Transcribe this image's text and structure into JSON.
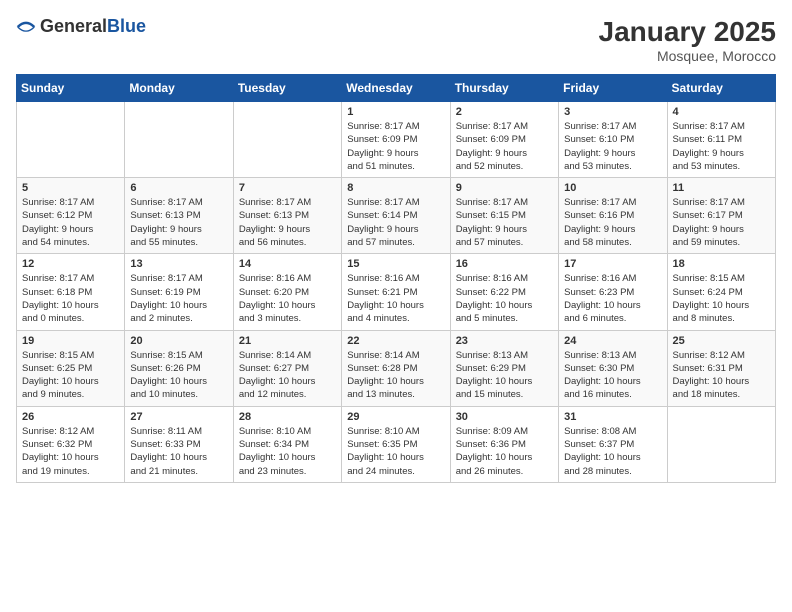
{
  "header": {
    "logo_general": "General",
    "logo_blue": "Blue",
    "month_year": "January 2025",
    "location": "Mosquee, Morocco"
  },
  "weekdays": [
    "Sunday",
    "Monday",
    "Tuesday",
    "Wednesday",
    "Thursday",
    "Friday",
    "Saturday"
  ],
  "weeks": [
    [
      {
        "day": "",
        "info": ""
      },
      {
        "day": "",
        "info": ""
      },
      {
        "day": "",
        "info": ""
      },
      {
        "day": "1",
        "info": "Sunrise: 8:17 AM\nSunset: 6:09 PM\nDaylight: 9 hours\nand 51 minutes."
      },
      {
        "day": "2",
        "info": "Sunrise: 8:17 AM\nSunset: 6:09 PM\nDaylight: 9 hours\nand 52 minutes."
      },
      {
        "day": "3",
        "info": "Sunrise: 8:17 AM\nSunset: 6:10 PM\nDaylight: 9 hours\nand 53 minutes."
      },
      {
        "day": "4",
        "info": "Sunrise: 8:17 AM\nSunset: 6:11 PM\nDaylight: 9 hours\nand 53 minutes."
      }
    ],
    [
      {
        "day": "5",
        "info": "Sunrise: 8:17 AM\nSunset: 6:12 PM\nDaylight: 9 hours\nand 54 minutes."
      },
      {
        "day": "6",
        "info": "Sunrise: 8:17 AM\nSunset: 6:13 PM\nDaylight: 9 hours\nand 55 minutes."
      },
      {
        "day": "7",
        "info": "Sunrise: 8:17 AM\nSunset: 6:13 PM\nDaylight: 9 hours\nand 56 minutes."
      },
      {
        "day": "8",
        "info": "Sunrise: 8:17 AM\nSunset: 6:14 PM\nDaylight: 9 hours\nand 57 minutes."
      },
      {
        "day": "9",
        "info": "Sunrise: 8:17 AM\nSunset: 6:15 PM\nDaylight: 9 hours\nand 57 minutes."
      },
      {
        "day": "10",
        "info": "Sunrise: 8:17 AM\nSunset: 6:16 PM\nDaylight: 9 hours\nand 58 minutes."
      },
      {
        "day": "11",
        "info": "Sunrise: 8:17 AM\nSunset: 6:17 PM\nDaylight: 9 hours\nand 59 minutes."
      }
    ],
    [
      {
        "day": "12",
        "info": "Sunrise: 8:17 AM\nSunset: 6:18 PM\nDaylight: 10 hours\nand 0 minutes."
      },
      {
        "day": "13",
        "info": "Sunrise: 8:17 AM\nSunset: 6:19 PM\nDaylight: 10 hours\nand 2 minutes."
      },
      {
        "day": "14",
        "info": "Sunrise: 8:16 AM\nSunset: 6:20 PM\nDaylight: 10 hours\nand 3 minutes."
      },
      {
        "day": "15",
        "info": "Sunrise: 8:16 AM\nSunset: 6:21 PM\nDaylight: 10 hours\nand 4 minutes."
      },
      {
        "day": "16",
        "info": "Sunrise: 8:16 AM\nSunset: 6:22 PM\nDaylight: 10 hours\nand 5 minutes."
      },
      {
        "day": "17",
        "info": "Sunrise: 8:16 AM\nSunset: 6:23 PM\nDaylight: 10 hours\nand 6 minutes."
      },
      {
        "day": "18",
        "info": "Sunrise: 8:15 AM\nSunset: 6:24 PM\nDaylight: 10 hours\nand 8 minutes."
      }
    ],
    [
      {
        "day": "19",
        "info": "Sunrise: 8:15 AM\nSunset: 6:25 PM\nDaylight: 10 hours\nand 9 minutes."
      },
      {
        "day": "20",
        "info": "Sunrise: 8:15 AM\nSunset: 6:26 PM\nDaylight: 10 hours\nand 10 minutes."
      },
      {
        "day": "21",
        "info": "Sunrise: 8:14 AM\nSunset: 6:27 PM\nDaylight: 10 hours\nand 12 minutes."
      },
      {
        "day": "22",
        "info": "Sunrise: 8:14 AM\nSunset: 6:28 PM\nDaylight: 10 hours\nand 13 minutes."
      },
      {
        "day": "23",
        "info": "Sunrise: 8:13 AM\nSunset: 6:29 PM\nDaylight: 10 hours\nand 15 minutes."
      },
      {
        "day": "24",
        "info": "Sunrise: 8:13 AM\nSunset: 6:30 PM\nDaylight: 10 hours\nand 16 minutes."
      },
      {
        "day": "25",
        "info": "Sunrise: 8:12 AM\nSunset: 6:31 PM\nDaylight: 10 hours\nand 18 minutes."
      }
    ],
    [
      {
        "day": "26",
        "info": "Sunrise: 8:12 AM\nSunset: 6:32 PM\nDaylight: 10 hours\nand 19 minutes."
      },
      {
        "day": "27",
        "info": "Sunrise: 8:11 AM\nSunset: 6:33 PM\nDaylight: 10 hours\nand 21 minutes."
      },
      {
        "day": "28",
        "info": "Sunrise: 8:10 AM\nSunset: 6:34 PM\nDaylight: 10 hours\nand 23 minutes."
      },
      {
        "day": "29",
        "info": "Sunrise: 8:10 AM\nSunset: 6:35 PM\nDaylight: 10 hours\nand 24 minutes."
      },
      {
        "day": "30",
        "info": "Sunrise: 8:09 AM\nSunset: 6:36 PM\nDaylight: 10 hours\nand 26 minutes."
      },
      {
        "day": "31",
        "info": "Sunrise: 8:08 AM\nSunset: 6:37 PM\nDaylight: 10 hours\nand 28 minutes."
      },
      {
        "day": "",
        "info": ""
      }
    ]
  ]
}
